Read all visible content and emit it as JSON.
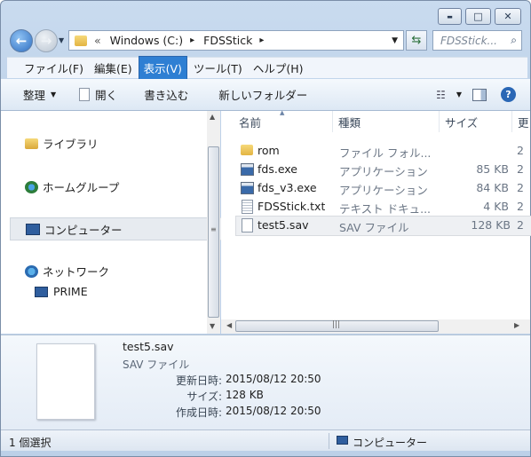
{
  "titlebar": {
    "minimize_glyph": "▬",
    "maximize_glyph": "□",
    "close_glyph": "✕"
  },
  "address": {
    "prefix": "«",
    "segments": [
      "Windows (C:)",
      "FDSStick"
    ],
    "separator": "▸"
  },
  "search": {
    "placeholder": "FDSStick..."
  },
  "menu": {
    "items": [
      "ファイル(F)",
      "編集(E)",
      "表示(V)",
      "ツール(T)",
      "ヘルプ(H)"
    ],
    "active_index": 2
  },
  "toolbar": {
    "organize": "整理",
    "open": "開く",
    "burn": "書き込む",
    "new_folder": "新しいフォルダー"
  },
  "nav": {
    "libraries": "ライブラリ",
    "homegroup": "ホームグループ",
    "computer": "コンピューター",
    "network": "ネットワーク",
    "prime": "PRIME"
  },
  "columns": {
    "name": "名前",
    "type": "種類",
    "size": "サイズ",
    "date_partial": "更"
  },
  "files": [
    {
      "name": "rom",
      "type": "ファイル フォル...",
      "size": "",
      "date": "2",
      "icon": "folder-icon"
    },
    {
      "name": "fds.exe",
      "type": "アプリケーション",
      "size": "85 KB",
      "date": "2",
      "icon": "exe-icon"
    },
    {
      "name": "fds_v3.exe",
      "type": "アプリケーション",
      "size": "84 KB",
      "date": "2",
      "icon": "exe-icon"
    },
    {
      "name": "FDSStick.txt",
      "type": "テキスト ドキュ...",
      "size": "4 KB",
      "date": "2",
      "icon": "text-file-icon"
    },
    {
      "name": "test5.sav",
      "type": "SAV ファイル",
      "size": "128 KB",
      "date": "2",
      "icon": "file-icon"
    }
  ],
  "details": {
    "filename": "test5.sav",
    "filetype": "SAV ファイル",
    "modified_label": "更新日時:",
    "modified_value": "2015/08/12 20:50",
    "size_label": "サイズ:",
    "size_value": "128 KB",
    "created_label": "作成日時:",
    "created_value": "2015/08/12 20:50"
  },
  "status": {
    "selection": "1 個選択",
    "location": "コンピューター"
  }
}
